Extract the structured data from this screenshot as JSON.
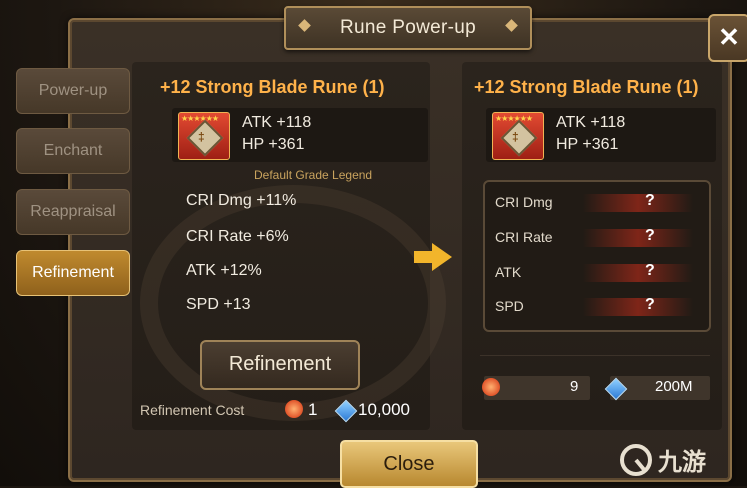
{
  "window": {
    "title": "Rune Power-up",
    "close_icon": "close-icon"
  },
  "tabs": [
    {
      "label": "Power-up",
      "active": false
    },
    {
      "label": "Enchant",
      "active": false
    },
    {
      "label": "Reappraisal",
      "active": false
    },
    {
      "label": "Refinement",
      "active": true
    }
  ],
  "current_rune": {
    "title": "+12 Strong Blade Rune (1)",
    "main_stats": [
      "ATK +118",
      "HP +361"
    ],
    "grade_legend": "Default Grade Legend",
    "sub_stats": [
      "CRI Dmg +11%",
      "CRI Rate +6%",
      "ATK +12%",
      "SPD +13"
    ],
    "stars": "★★★★★★"
  },
  "refine_button": "Refinement",
  "cost": {
    "label": "Refinement Cost",
    "rune_qty": "1",
    "crystal_qty": "10,000"
  },
  "result_rune": {
    "title": "+12 Strong Blade Rune (1)",
    "main_stats": [
      "ATK +118",
      "HP +361"
    ],
    "stars": "★★★★★★",
    "unknown_stats": [
      {
        "label": "CRI Dmg",
        "value": "?"
      },
      {
        "label": "CRI Rate",
        "value": "?"
      },
      {
        "label": "ATK",
        "value": "?"
      },
      {
        "label": "SPD",
        "value": "?"
      }
    ]
  },
  "inventory": {
    "rune_qty": "9",
    "crystal_qty": "200M"
  },
  "close_button": "Close",
  "watermark": "九游",
  "colors": {
    "accent": "#ffb24a",
    "arrow": "#f2b52b",
    "active_tab": "#c08a2e"
  }
}
